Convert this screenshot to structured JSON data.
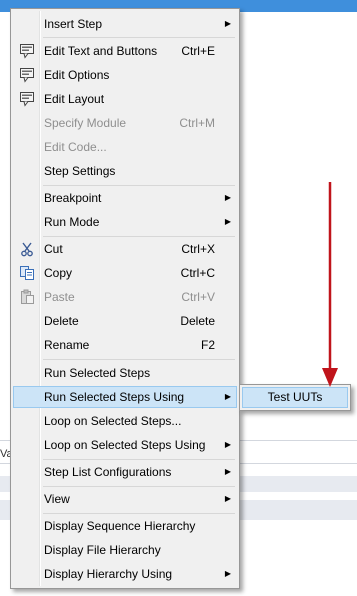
{
  "menu": {
    "items": [
      {
        "label": "Insert Step",
        "shortcut": "",
        "submenu": true,
        "icon": "",
        "disabled": false
      },
      {
        "label": "Edit Text and Buttons",
        "shortcut": "Ctrl+E",
        "submenu": false,
        "icon": "edit-dialog-icon",
        "disabled": false
      },
      {
        "label": "Edit Options",
        "shortcut": "",
        "submenu": false,
        "icon": "edit-dialog-icon",
        "disabled": false
      },
      {
        "label": "Edit Layout",
        "shortcut": "",
        "submenu": false,
        "icon": "edit-dialog-icon",
        "disabled": false
      },
      {
        "label": "Specify Module",
        "shortcut": "Ctrl+M",
        "submenu": false,
        "icon": "",
        "disabled": true
      },
      {
        "label": "Edit Code...",
        "shortcut": "",
        "submenu": false,
        "icon": "",
        "disabled": true
      },
      {
        "label": "Step Settings",
        "shortcut": "",
        "submenu": false,
        "icon": "",
        "disabled": false
      },
      {
        "label": "Breakpoint",
        "shortcut": "",
        "submenu": true,
        "icon": "",
        "disabled": false
      },
      {
        "label": "Run Mode",
        "shortcut": "",
        "submenu": true,
        "icon": "",
        "disabled": false
      },
      {
        "label": "Cut",
        "shortcut": "Ctrl+X",
        "submenu": false,
        "icon": "scissors-icon",
        "disabled": false
      },
      {
        "label": "Copy",
        "shortcut": "Ctrl+C",
        "submenu": false,
        "icon": "copy-icon",
        "disabled": false
      },
      {
        "label": "Paste",
        "shortcut": "Ctrl+V",
        "submenu": false,
        "icon": "paste-icon",
        "disabled": true
      },
      {
        "label": "Delete",
        "shortcut": "Delete",
        "submenu": false,
        "icon": "",
        "disabled": false
      },
      {
        "label": "Rename",
        "shortcut": "F2",
        "submenu": false,
        "icon": "",
        "disabled": false
      },
      {
        "label": "Run Selected Steps",
        "shortcut": "",
        "submenu": false,
        "icon": "",
        "disabled": false
      },
      {
        "label": "Run Selected Steps Using",
        "shortcut": "",
        "submenu": true,
        "icon": "",
        "disabled": false,
        "highlighted": true
      },
      {
        "label": "Loop on Selected Steps...",
        "shortcut": "",
        "submenu": false,
        "icon": "",
        "disabled": false
      },
      {
        "label": "Loop on Selected Steps Using",
        "shortcut": "",
        "submenu": true,
        "icon": "",
        "disabled": false
      },
      {
        "label": "Step List Configurations",
        "shortcut": "",
        "submenu": true,
        "icon": "",
        "disabled": false
      },
      {
        "label": "View",
        "shortcut": "",
        "submenu": true,
        "icon": "",
        "disabled": false
      },
      {
        "label": "Display Sequence Hierarchy",
        "shortcut": "",
        "submenu": false,
        "icon": "",
        "disabled": false
      },
      {
        "label": "Display File Hierarchy",
        "shortcut": "",
        "submenu": false,
        "icon": "",
        "disabled": false
      },
      {
        "label": "Display Hierarchy Using",
        "shortcut": "",
        "submenu": true,
        "icon": "",
        "disabled": false
      }
    ]
  },
  "submenu": {
    "items": [
      {
        "label": "Test UUTs"
      }
    ]
  },
  "background": {
    "partial_label": "Va"
  },
  "colors": {
    "highlight": "#cce4f7",
    "highlight_border": "#99c9ef",
    "annotation_arrow": "#c0141b",
    "menu_bg": "#f0f0f0",
    "disabled_text": "#8f8f8f"
  }
}
